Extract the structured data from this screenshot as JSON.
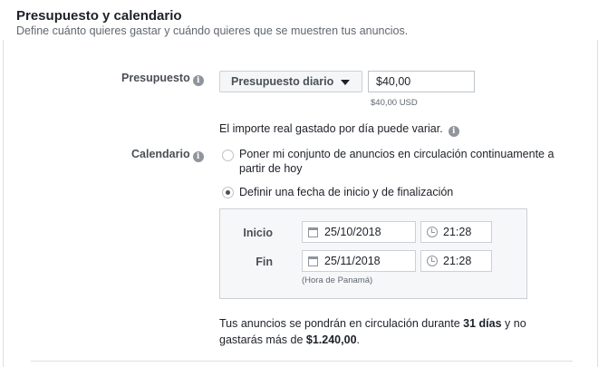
{
  "header": {
    "title": "Presupuesto y calendario",
    "subtitle": "Define cuánto quieres gastar y cuándo quieres que se muestren tus anuncios."
  },
  "budget": {
    "label": "Presupuesto",
    "type_selected": "Presupuesto diario",
    "amount_value": "$40,00",
    "amount_hint": "$40,00 USD",
    "note": "El importe real gastado por día puede variar."
  },
  "schedule": {
    "label": "Calendario",
    "option_continuous": "Poner mi conjunto de anuncios en circulación continuamente a partir de hoy",
    "option_dates": "Definir una fecha de inicio y de finalización",
    "selected": "dates",
    "start_label": "Inicio",
    "start_date": "25/10/2018",
    "start_time": "21:28",
    "end_label": "Fin",
    "end_date": "25/11/2018",
    "end_time": "21:28",
    "timezone": "(Hora de Panamá)"
  },
  "summary": {
    "prefix": "Tus anuncios se pondrán en circulación durante",
    "days": "31 días",
    "middle": "y no gastarás más de",
    "total": "$1.240,00",
    "suffix": "."
  },
  "icons": {
    "info": "info-icon",
    "calendar": "calendar-icon",
    "clock": "clock-icon",
    "dropdown": "caret-down-icon"
  }
}
